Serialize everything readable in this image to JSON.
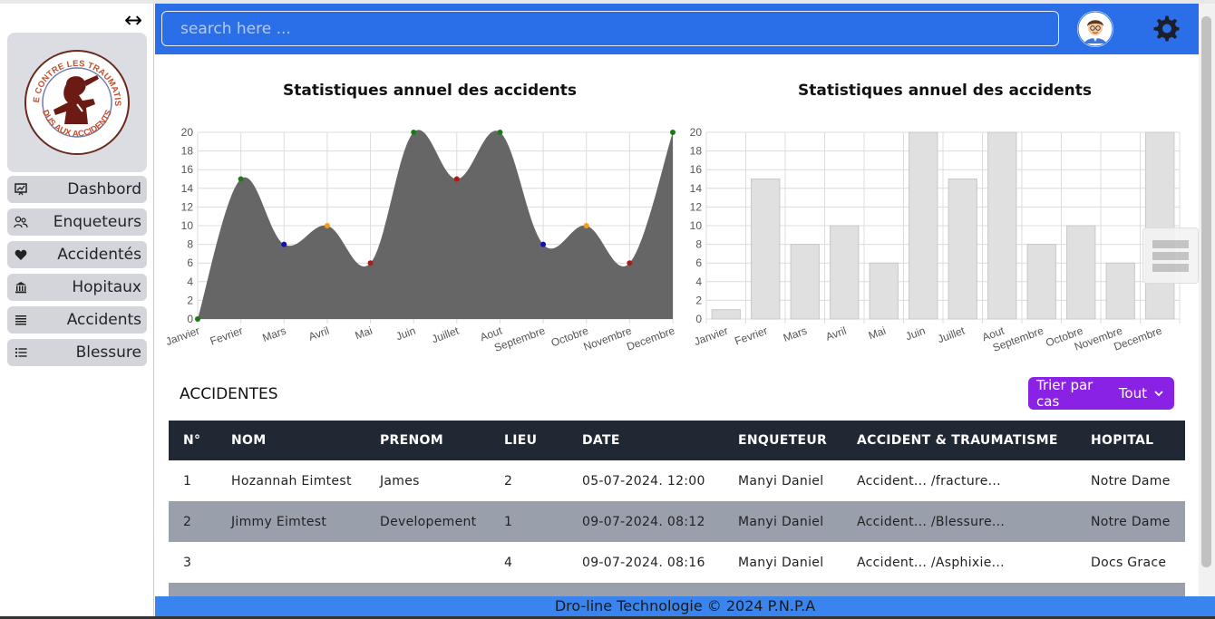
{
  "sidebar": {
    "toggle_icon": "↔",
    "logo": {
      "text_top": "LUTTE CONTRE LES TRAUMATISMES",
      "text_bottom": "DUS AUX ACCIDENTS"
    },
    "items": [
      {
        "label": "Dashbord",
        "icon": "dashboard-icon"
      },
      {
        "label": "Enqueteurs",
        "icon": "users-icon"
      },
      {
        "label": "Accidentés",
        "icon": "heart-icon"
      },
      {
        "label": "Hopitaux",
        "icon": "bank-icon"
      },
      {
        "label": "Accidents",
        "icon": "lines-icon"
      },
      {
        "label": "Blessure",
        "icon": "list-icon"
      }
    ]
  },
  "header": {
    "search_placeholder": "search here ...",
    "accent": "#2b6fe8"
  },
  "charts": {
    "line_title": "Statistiques annuel des accidents",
    "bar_title": "Statistiques annuel des accidents"
  },
  "chart_data": [
    {
      "type": "area",
      "title": "Statistiques annuel des accidents",
      "categories": [
        "Janvier",
        "Fevrier",
        "Mars",
        "Avril",
        "Mai",
        "Juin",
        "Juillet",
        "Aout",
        "Septembre",
        "Octobre",
        "Novembre",
        "Decembre"
      ],
      "values": [
        0,
        15,
        8,
        10,
        6,
        20,
        15,
        20,
        8,
        10,
        6,
        20
      ],
      "point_colors": [
        "#1a7a1a",
        "#1a7a1a",
        "#1010c0",
        "#f0a020",
        "#a02020",
        "#1a7a1a",
        "#c01010",
        "#1a7a1a",
        "#1010c0",
        "#f0a020",
        "#a02020",
        "#1a7a1a"
      ],
      "yticks": [
        0,
        2,
        4,
        6,
        8,
        10,
        12,
        14,
        16,
        18,
        20
      ],
      "ylim": [
        0,
        20
      ],
      "fill": "#666666",
      "grid": true
    },
    {
      "type": "bar",
      "title": "Statistiques annuel des accidents",
      "categories": [
        "Janvier",
        "Fevrier",
        "Mars",
        "Avril",
        "Mai",
        "Juin",
        "Juillet",
        "Aout",
        "Septembre",
        "Octobre",
        "Novembre",
        "Decembre"
      ],
      "values": [
        1,
        15,
        8,
        10,
        6,
        20,
        15,
        20,
        8,
        10,
        6,
        20
      ],
      "yticks": [
        0,
        2,
        4,
        6,
        8,
        10,
        12,
        14,
        16,
        18,
        20
      ],
      "ylim": [
        0,
        20
      ],
      "fill": "#e0e0e0",
      "grid": true
    }
  ],
  "section": {
    "title": "ACCIDENTES",
    "sort_label": "Trier par cas",
    "sort_value": "Tout",
    "sort_color": "#8a22e6"
  },
  "table": {
    "headers": [
      "N°",
      "NOM",
      "PRENOM",
      "LIEU",
      "DATE",
      "ENQUETEUR",
      "ACCIDENT & TRAUMATISME",
      "HOPITAL"
    ],
    "rows": [
      [
        "1",
        "Hozannah Eimtest",
        "James",
        "2",
        "05-07-2024. 12:00",
        "Manyi Daniel",
        "Accident... /fracture...",
        "Notre Dame"
      ],
      [
        "2",
        "Jimmy Eimtest",
        "Developement",
        "1",
        "09-07-2024. 08:12",
        "Manyi Daniel",
        "Accident... /Blessure...",
        "Notre Dame"
      ],
      [
        "3",
        "",
        "",
        "4",
        "09-07-2024. 08:16",
        "Manyi Daniel",
        "Accident... /Asphixie...",
        "Docs Grace"
      ],
      [
        "",
        "",
        "",
        "",
        "",
        "",
        "",
        ""
      ]
    ]
  },
  "footer": {
    "text": "Dro-line Technologie © 2024 P.N.P.A"
  }
}
